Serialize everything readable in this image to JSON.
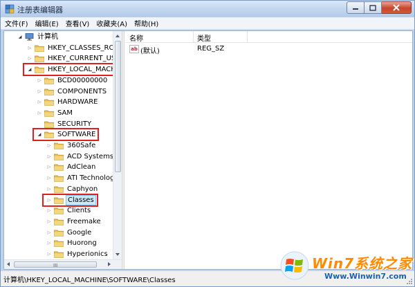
{
  "window": {
    "title": "注册表编辑器",
    "controls": {
      "minimize": "min-icon",
      "maximize": "max-icon",
      "close": "close-icon"
    }
  },
  "menu": [
    "文件(F)",
    "编辑(E)",
    "查看(V)",
    "收藏夹(A)",
    "帮助(H)"
  ],
  "tree": [
    {
      "label": "计算机",
      "level": 0,
      "state": "open",
      "icon": "computer-icon"
    },
    {
      "label": "HKEY_CLASSES_ROOT",
      "level": 1,
      "state": "closed",
      "icon": "folder-icon"
    },
    {
      "label": "HKEY_CURRENT_USER",
      "level": 1,
      "state": "closed",
      "icon": "folder-icon"
    },
    {
      "label": "HKEY_LOCAL_MACHINE",
      "level": 1,
      "state": "open",
      "icon": "folder-icon",
      "highlighted": true
    },
    {
      "label": "BCD00000000",
      "level": 2,
      "state": "closed",
      "icon": "folder-icon"
    },
    {
      "label": "COMPONENTS",
      "level": 2,
      "state": "closed",
      "icon": "folder-icon"
    },
    {
      "label": "HARDWARE",
      "level": 2,
      "state": "closed",
      "icon": "folder-icon"
    },
    {
      "label": "SAM",
      "level": 2,
      "state": "closed",
      "icon": "folder-icon"
    },
    {
      "label": "SECURITY",
      "level": 2,
      "state": "none",
      "icon": "folder-icon"
    },
    {
      "label": "SOFTWARE",
      "level": 2,
      "state": "open",
      "icon": "folder-icon",
      "highlighted": true
    },
    {
      "label": "360Safe",
      "level": 3,
      "state": "closed",
      "icon": "folder-icon"
    },
    {
      "label": "ACD Systems",
      "level": 3,
      "state": "closed",
      "icon": "folder-icon"
    },
    {
      "label": "AdClean",
      "level": 3,
      "state": "closed",
      "icon": "folder-icon"
    },
    {
      "label": "ATI Technologie",
      "level": 3,
      "state": "closed",
      "icon": "folder-icon"
    },
    {
      "label": "Caphyon",
      "level": 3,
      "state": "closed",
      "icon": "folder-icon"
    },
    {
      "label": "Classes",
      "level": 3,
      "state": "closed",
      "icon": "folder-icon",
      "highlighted": true,
      "selected": true
    },
    {
      "label": "Clients",
      "level": 3,
      "state": "closed",
      "icon": "folder-icon"
    },
    {
      "label": "Freemake",
      "level": 3,
      "state": "closed",
      "icon": "folder-icon"
    },
    {
      "label": "Google",
      "level": 3,
      "state": "closed",
      "icon": "folder-icon"
    },
    {
      "label": "Huorong",
      "level": 3,
      "state": "closed",
      "icon": "folder-icon"
    },
    {
      "label": "Hyperionics",
      "level": 3,
      "state": "closed",
      "icon": "folder-icon"
    }
  ],
  "scrollbar": {
    "horizontal_grip": "III"
  },
  "list": {
    "columns": {
      "name": "名称",
      "type": "类型"
    },
    "rows": [
      {
        "name": "(默认)",
        "type": "REG_SZ",
        "icon": "ab",
        "icon_name": "reg-sz-icon"
      }
    ]
  },
  "status": {
    "path": "计算机\\HKEY_LOCAL_MACHINE\\SOFTWARE\\Classes"
  },
  "watermark": {
    "brand": "Win7系统之家",
    "url": "Www.Winwin7.com"
  },
  "colors": {
    "highlight_border": "#e01f1f",
    "selection_bg": "#cde8fb",
    "folder": "#e8c15a"
  }
}
